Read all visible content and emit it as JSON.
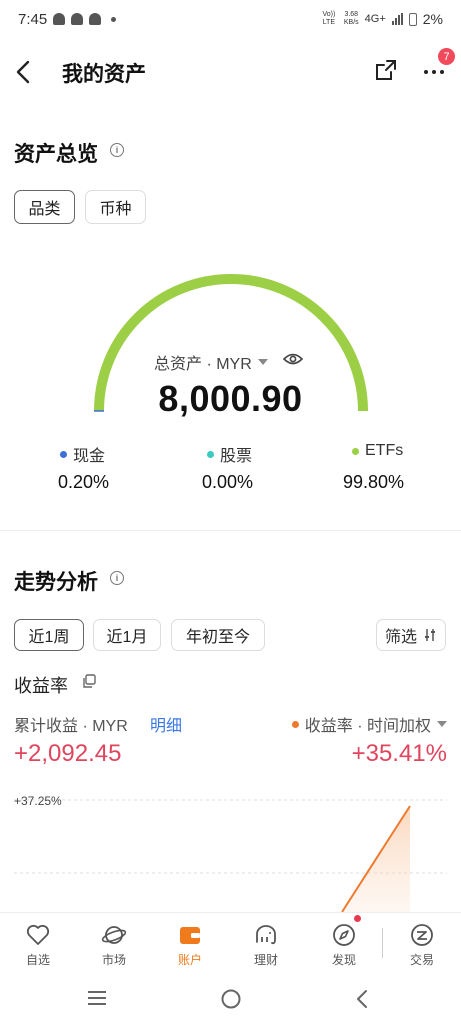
{
  "status_bar": {
    "time": "7:45",
    "network_top": "Vo)) LTE",
    "speed_value": "3.68",
    "speed_unit": "KB/s",
    "network": "4G+",
    "battery": "2%"
  },
  "header": {
    "title": "我的资产",
    "notification_count": "7"
  },
  "overview": {
    "title": "资产总览",
    "tabs": [
      {
        "label": "品类",
        "active": true
      },
      {
        "label": "币种",
        "active": false
      }
    ],
    "gauge": {
      "label": "总资产 · MYR",
      "total": "8,000.90",
      "colors": {
        "etf": "#9ccf46",
        "cash": "#3d6fd6"
      }
    },
    "legend": [
      {
        "label": "现金",
        "percent": "0.20%",
        "color": "#3d6fd6"
      },
      {
        "label": "股票",
        "percent": "0.00%",
        "color": "#3cc9c2"
      },
      {
        "label": "ETFs",
        "percent": "99.80%",
        "color": "#9ccf46"
      }
    ]
  },
  "trend": {
    "title": "走势分析",
    "periods": [
      {
        "label": "近1周",
        "active": true
      },
      {
        "label": "近1月",
        "active": false
      },
      {
        "label": "年初至今",
        "active": false
      }
    ],
    "filter_label": "筛选",
    "yield_label": "收益率",
    "cumulative_label": "累计收益 · MYR",
    "detail_link": "明细",
    "rate_label": "收益率 · 时间加权",
    "cumulative_value": "+2,092.45",
    "rate_value": "+35.41%",
    "chart_top_label": "+37.25%"
  },
  "tabbar": {
    "items": [
      {
        "label": "自选",
        "icon": "heart-icon",
        "active": false
      },
      {
        "label": "市场",
        "icon": "planet-icon",
        "active": false
      },
      {
        "label": "账户",
        "icon": "wallet-icon",
        "active": true
      },
      {
        "label": "理财",
        "icon": "elephant-icon",
        "active": false
      },
      {
        "label": "发现",
        "icon": "compass-icon",
        "active": false
      },
      {
        "label": "交易",
        "icon": "trade-icon",
        "active": false
      }
    ]
  },
  "colors": {
    "accent": "#f07b1d",
    "gain": "#e0455e",
    "link": "#3a78e7"
  }
}
